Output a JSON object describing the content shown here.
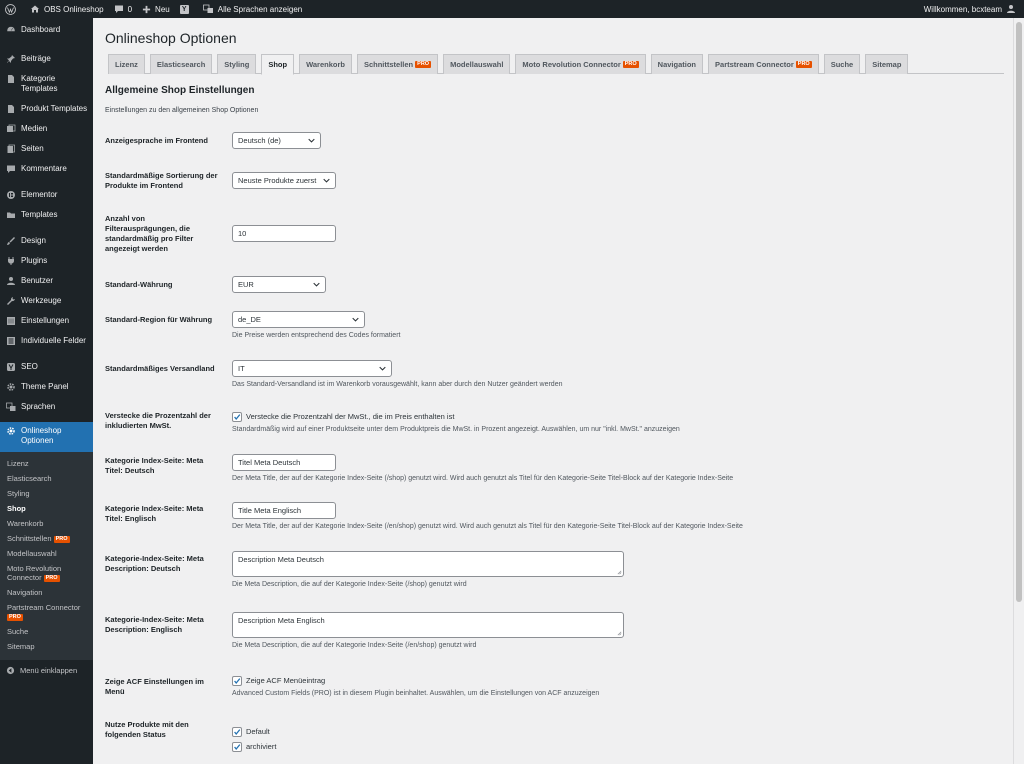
{
  "adminbar": {
    "site_name": "OBS Onlineshop",
    "comments_count": "0",
    "new_label": "Neu",
    "yoast_badge": "Y",
    "languages_label": "Alle Sprachen anzeigen",
    "welcome": "Willkommen, bcxteam"
  },
  "sidebar": {
    "items": [
      {
        "label": "Dashboard"
      },
      {
        "label": "Beiträge"
      },
      {
        "label": "Kategorie Templates"
      },
      {
        "label": "Produkt Templates"
      },
      {
        "label": "Medien"
      },
      {
        "label": "Seiten"
      },
      {
        "label": "Kommentare"
      },
      {
        "label": "Elementor"
      },
      {
        "label": "Templates"
      },
      {
        "label": "Design"
      },
      {
        "label": "Plugins"
      },
      {
        "label": "Benutzer"
      },
      {
        "label": "Werkzeuge"
      },
      {
        "label": "Einstellungen"
      },
      {
        "label": "Individuelle Felder"
      },
      {
        "label": "SEO"
      },
      {
        "label": "Theme Panel"
      },
      {
        "label": "Sprachen"
      },
      {
        "label": "Onlineshop Optionen"
      }
    ],
    "submenu": [
      {
        "label": "Lizenz"
      },
      {
        "label": "Elasticsearch"
      },
      {
        "label": "Styling"
      },
      {
        "label": "Shop"
      },
      {
        "label": "Warenkorb"
      },
      {
        "label": "Schnittstellen"
      },
      {
        "label": "Modellauswahl"
      },
      {
        "label": "Moto Revolution Connector"
      },
      {
        "label": "Navigation"
      },
      {
        "label": "Partstream Connector"
      },
      {
        "label": "Suche"
      },
      {
        "label": "Sitemap"
      }
    ],
    "pro_badge": "PRO",
    "collapse_label": "Menü einklappen"
  },
  "page": {
    "title": "Onlineshop Optionen",
    "tabs": [
      {
        "label": "Lizenz"
      },
      {
        "label": "Elasticsearch"
      },
      {
        "label": "Styling"
      },
      {
        "label": "Shop"
      },
      {
        "label": "Warenkorb"
      },
      {
        "label": "Schnittstellen"
      },
      {
        "label": "Modellauswahl"
      },
      {
        "label": "Moto Revolution Connector"
      },
      {
        "label": "Navigation"
      },
      {
        "label": "Partstream Connector"
      },
      {
        "label": "Suche"
      },
      {
        "label": "Sitemap"
      }
    ],
    "active_tab": "Shop",
    "section_title": "Allgemeine Shop Einstellungen",
    "section_desc": "Einstellungen zu den allgemeinen Shop Optionen"
  },
  "fields": {
    "frontend_language": {
      "label": "Anzeigesprache im Frontend",
      "value": "Deutsch (de)"
    },
    "sorting": {
      "label": "Standardmäßige Sortierung der Produkte im Frontend",
      "value": "Neuste Produkte zuerst"
    },
    "filter_count": {
      "label": "Anzahl von Filterausprägungen, die standardmäßig pro Filter angezeigt werden",
      "value": "10"
    },
    "currency": {
      "label": "Standard-Währung",
      "value": "EUR"
    },
    "region": {
      "label": "Standard-Region für Währung",
      "value": "de_DE",
      "desc": "Die Preise werden entsprechend des Codes formatiert"
    },
    "shipping_country": {
      "label": "Standardmäßiges Versandland",
      "value": "IT",
      "desc": "Das Standard-Versandland ist im Warenkorb vorausgewählt, kann aber durch den Nutzer geändert werden"
    },
    "hide_vat": {
      "label": "Verstecke die Prozentzahl der inkludierten MwSt.",
      "check_label": "Verstecke die Prozentzahl der MwSt., die im Preis enthalten ist",
      "checked": true,
      "desc": "Standardmäßig wird auf einer Produktseite unter dem Produktpreis die MwSt. in Prozent angezeigt. Auswählen, um nur \"inkl. MwSt.\" anzuzeigen"
    },
    "meta_title_de": {
      "label": "Kategorie Index-Seite: Meta Titel: Deutsch",
      "value": "Titel Meta Deutsch",
      "desc": "Der Meta Title, der auf der Kategorie Index-Seite (/shop) genutzt wird. Wird auch genutzt als Titel für den Kategorie-Seite Titel-Block auf der Kategorie Index-Seite"
    },
    "meta_title_en": {
      "label": "Kategorie Index-Seite: Meta Titel: Englisch",
      "value": "Title Meta Englisch",
      "desc": "Der Meta Title, der auf der Kategorie Index-Seite (/en/shop) genutzt wird. Wird auch genutzt als Titel für den Kategorie-Seite Titel-Block auf der Kategorie Index-Seite"
    },
    "meta_desc_de": {
      "label": "Kategorie-Index-Seite: Meta Description: Deutsch",
      "value": "Description Meta Deutsch",
      "desc": "Die Meta Description, die auf der Kategorie Index-Seite (/shop) genutzt wird"
    },
    "meta_desc_en": {
      "label": "Kategorie-Index-Seite: Meta Description: Englisch",
      "value": "Description Meta Englisch",
      "desc": "Die Meta Description, die auf der Kategorie Index-Seite (/en/shop) genutzt wird"
    },
    "acf": {
      "label": "Zeige ACF Einstellungen im Menü",
      "check_label": "Zeige ACF Menüeintrag",
      "checked": true,
      "desc": "Advanced Custom Fields (PRO) ist in diesem Plugin beinhaltet. Auswählen, um die Einstellungen von ACF anzuzeigen"
    },
    "status": {
      "label": "Nutze Produkte mit den folgenden Status",
      "options": [
        {
          "label": "Default",
          "checked": true
        },
        {
          "label": "archiviert",
          "checked": true
        }
      ]
    }
  }
}
